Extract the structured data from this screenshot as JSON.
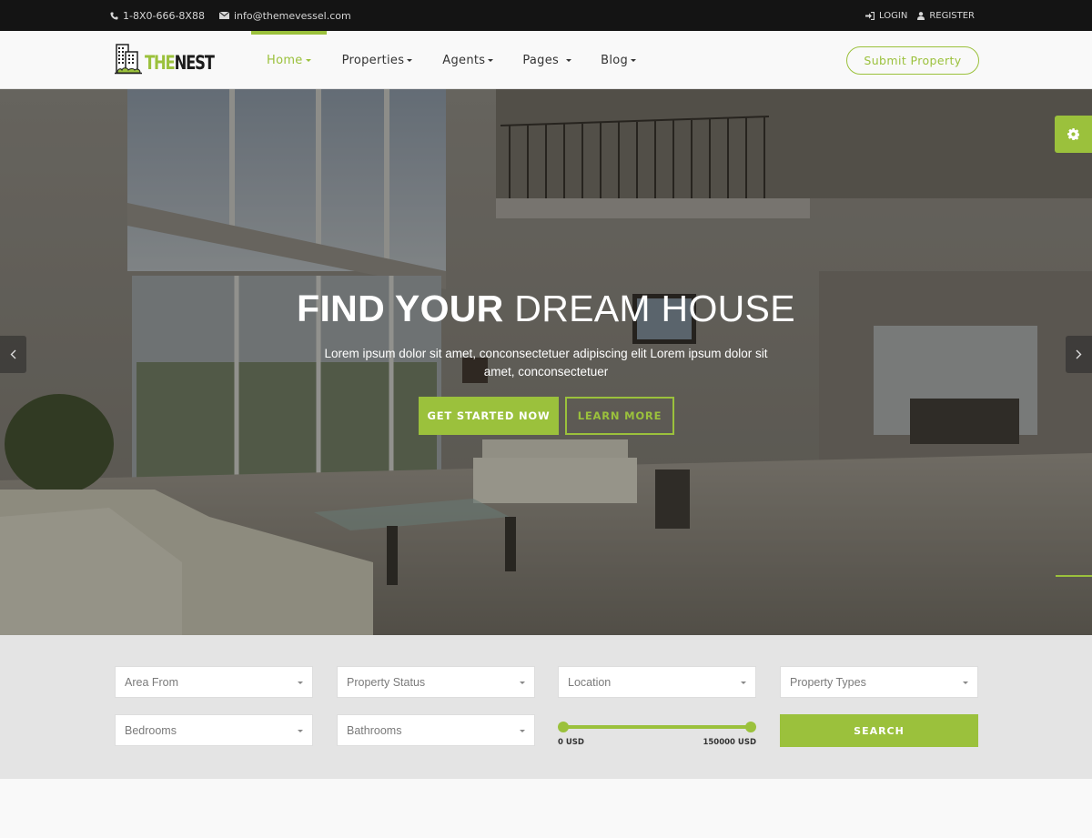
{
  "topbar": {
    "phone": "1-8X0-666-8X88",
    "email": "info@themevessel.com",
    "login": "LOGIN",
    "register": "REGISTER"
  },
  "header": {
    "logo_the": "THE",
    "logo_nest": "NEST",
    "nav": [
      {
        "label": "Home",
        "active": true
      },
      {
        "label": "Properties",
        "active": false
      },
      {
        "label": "Agents",
        "active": false
      },
      {
        "label": "Pages",
        "active": false
      },
      {
        "label": "Blog",
        "active": false
      }
    ],
    "submit_label": "Submit Property"
  },
  "hero": {
    "title_bold": "FIND YOUR",
    "title_light": "DREAM HOUSE",
    "subtitle": "Lorem ipsum dolor sit amet, conconsectetuer adipiscing elit Lorem ipsum dolor sit amet, conconsectetuer",
    "primary_cta": "GET STARTED NOW",
    "secondary_cta": "LEARN MORE"
  },
  "search": {
    "selects": [
      {
        "placeholder": "Area From"
      },
      {
        "placeholder": "Property Status"
      },
      {
        "placeholder": "Location"
      },
      {
        "placeholder": "Property Types"
      },
      {
        "placeholder": "Bedrooms"
      },
      {
        "placeholder": "Bathrooms"
      }
    ],
    "price_range": {
      "min_label": "0 USD",
      "max_label": "150000 USD",
      "min": 0,
      "max": 150000
    },
    "search_label": "SEARCH"
  },
  "colors": {
    "accent": "#9bc13c",
    "topbar_bg": "#141414",
    "search_bg": "#e4e4e4"
  }
}
